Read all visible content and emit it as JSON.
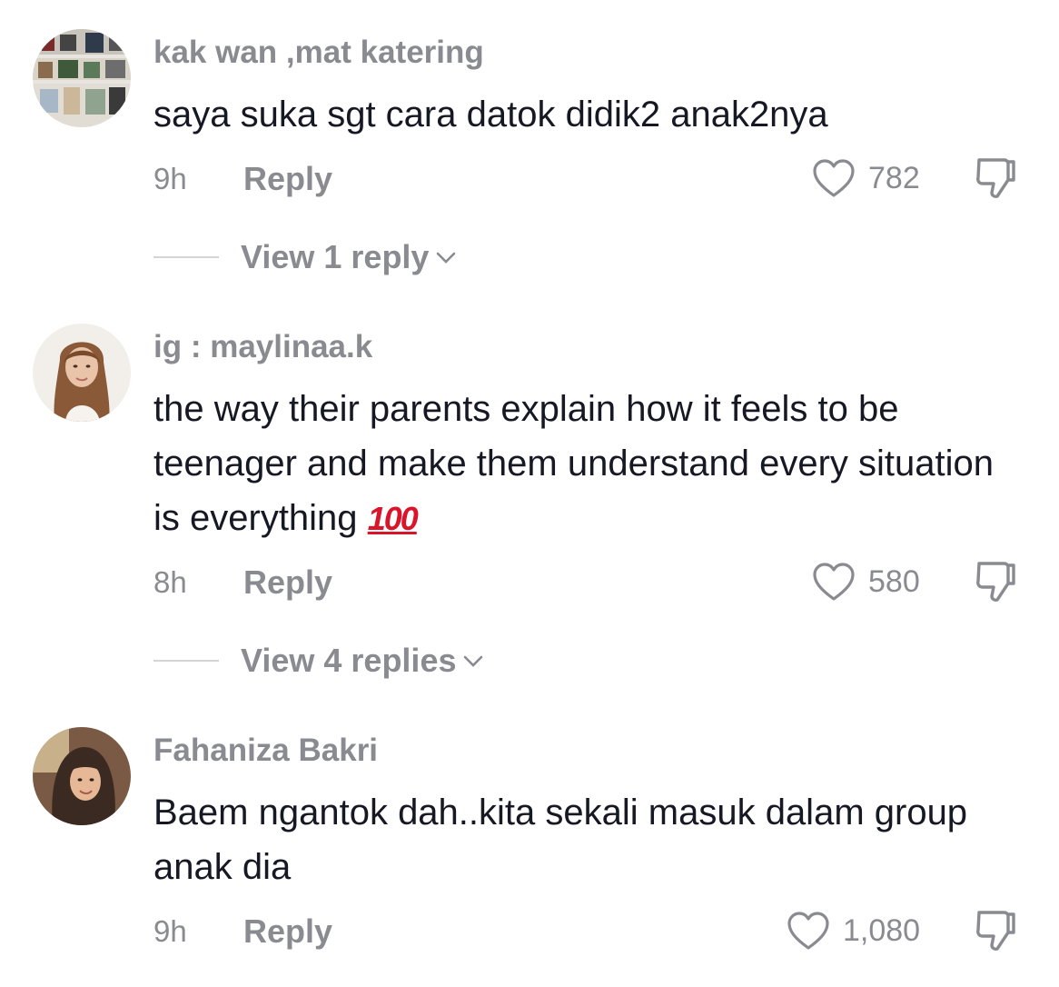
{
  "comments": [
    {
      "username": "kak wan ,mat katering",
      "text": "saya suka sgt cara datok didik2 anak2nya",
      "time": "9h",
      "reply_label": "Reply",
      "likes": "782",
      "view_replies": "View 1 reply",
      "avatar_icon": "collage-photo-avatar"
    },
    {
      "username": "ig : maylinaa.k",
      "text": "the way their parents explain how it feels to be teenager and make them understand every situation is everything",
      "emoji": "100",
      "time": "8h",
      "reply_label": "Reply",
      "likes": "580",
      "view_replies": "View 4 replies",
      "avatar_icon": "woman-portrait-avatar"
    },
    {
      "username": "Fahaniza Bakri",
      "text": "Baem ngantok dah..kita sekali masuk dalam group anak dia",
      "time": "9h",
      "reply_label": "Reply",
      "likes": "1,080",
      "avatar_icon": "hijab-woman-avatar"
    }
  ],
  "colors": {
    "muted": "#8a8b91",
    "text": "#161823",
    "emoji_red": "#d8152a"
  }
}
